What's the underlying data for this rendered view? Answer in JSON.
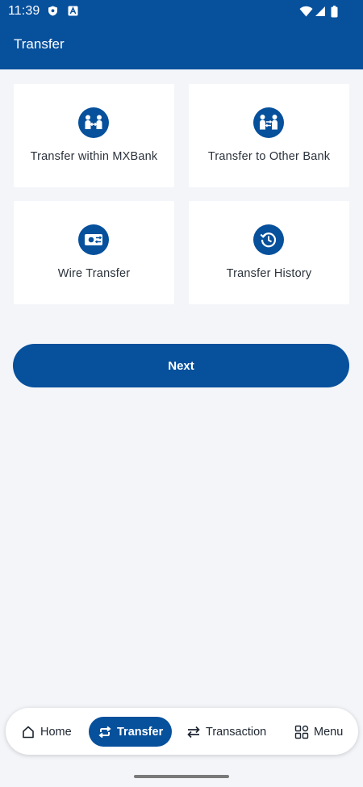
{
  "status_bar": {
    "time": "11:39"
  },
  "app_bar": {
    "title": "Transfer"
  },
  "options": [
    {
      "label": "Transfer within MXBank",
      "icon": "people-transfer-icon"
    },
    {
      "label": "Transfer to Other Bank",
      "icon": "people-exchange-icon"
    },
    {
      "label": "Wire Transfer",
      "icon": "cash-transfer-icon"
    },
    {
      "label": "Transfer History",
      "icon": "history-icon"
    }
  ],
  "next_button": {
    "label": "Next"
  },
  "bottom_nav": {
    "items": [
      {
        "label": "Home",
        "icon": "home-icon",
        "active": false
      },
      {
        "label": "Transfer",
        "icon": "transfer-arrows-icon",
        "active": true
      },
      {
        "label": "Transaction",
        "icon": "swap-arrows-icon",
        "active": false
      },
      {
        "label": "Menu",
        "icon": "grid-menu-icon",
        "active": false
      }
    ]
  },
  "colors": {
    "primary": "#06509c",
    "background": "#f3f5f9",
    "card": "#ffffff"
  }
}
